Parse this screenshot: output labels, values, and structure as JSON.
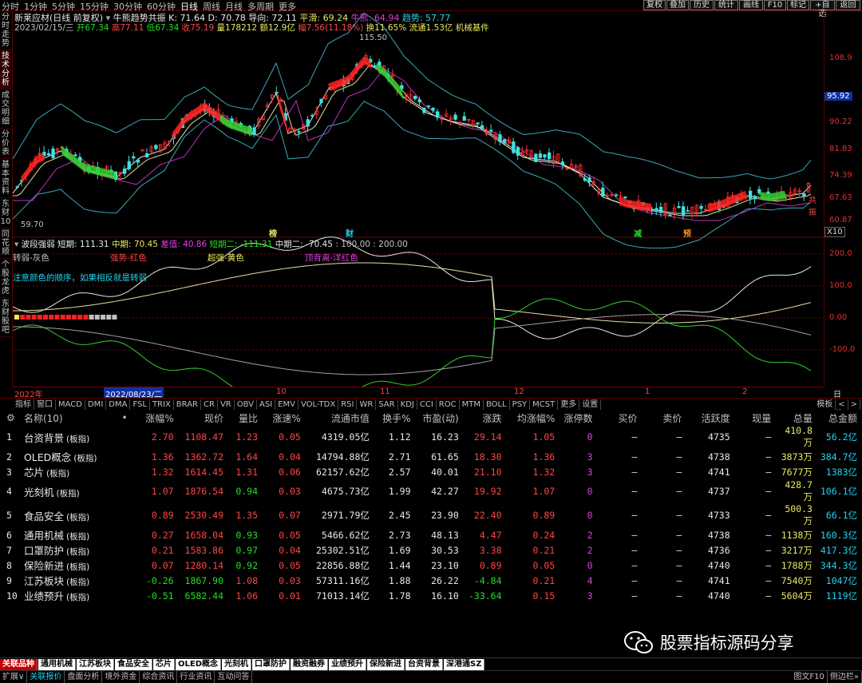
{
  "topbar": {
    "periods": [
      "分时",
      "1分钟",
      "5分钟",
      "15分钟",
      "30分钟",
      "60分钟",
      "日线",
      "周线",
      "月线",
      "多周期",
      "更多"
    ],
    "selected": "日线",
    "buttons": [
      "复权",
      "叠加",
      "历史",
      "统计",
      "画线",
      "F10",
      "标记",
      "+自选",
      "返回"
    ]
  },
  "lefttabs": [
    "分时走势",
    "技术分析",
    "成交明细",
    "分价表",
    "基本资料",
    "东财10",
    "同花顺",
    "个股龙虎",
    "东财股吧"
  ],
  "header": {
    "title": "新莱应材(日线 前复权)",
    "indicator_name": "牛熊趋势共振",
    "k": "K: 71.64",
    "d": "D: 70.78",
    "daoxiang": "导向: 72.11",
    "pinghua": "平滑: 69.24",
    "niuxiong": "牛熊: 64.94",
    "qushi": "趋势: 57.77",
    "date": "2023/02/15/三",
    "open": "开67.34",
    "high": "高77.11",
    "low": "低67.34",
    "close": "收75.19",
    "vol": "量178212",
    "amount": "额12.9亿",
    "amp": "幅7.56(11.18%)",
    "turnover": "换11.65%",
    "float": "流通1.53亿",
    "sector": "机械基件"
  },
  "price_scale": [
    "108.9",
    "95.92",
    "90.22",
    "81.83",
    "74.39",
    "67.63",
    "60.87"
  ],
  "price_current": "95.92",
  "chart_annotations": {
    "high": "115.50",
    "low": "59.70",
    "right_tag": "共振",
    "markers": [
      "榜",
      "财",
      "减",
      "预"
    ],
    "x10": "X10"
  },
  "sub": {
    "title": "波段强弱",
    "dq": "短期: 111.31",
    "zq": "中期: 70.45",
    "cz": "差值: 40.86",
    "dq2": "短期二: -111.31",
    "zq2": "中期二: -70.45",
    "range": ": 100.00 : 200.00",
    "legend1": "转弱-灰色",
    "legend2": "强势-红色",
    "legend3": "超强-黄色",
    "legend4": "顶背离-洋红色",
    "note": "注意颜色的顺序，如果相反就是转弱",
    "scale": [
      "200.0",
      "100.0",
      "0.00",
      "-100.0"
    ]
  },
  "xaxis": {
    "labels": [
      "2022年",
      "2022/08/23/二",
      "10",
      "11",
      "12",
      "1",
      "2"
    ],
    "right": "日线"
  },
  "ctoolbar": [
    "指标",
    "窗口",
    "MACD",
    "DMI",
    "DMA",
    "FSL",
    "TRIX",
    "BRAR",
    "CR",
    "VR",
    "OBV",
    "ASI",
    "EMV",
    "VOL-TDX",
    "RSI",
    "WR",
    "SAR",
    "KDJ",
    "CCI",
    "ROC",
    "MTM",
    "BOLL",
    "PSY",
    "MCST",
    "更多",
    "设置"
  ],
  "ctoolbar_right": [
    "模板",
    "<",
    ">"
  ],
  "table": {
    "headers": [
      "名称(10)",
      "•",
      "涨幅%",
      "现价",
      "量比",
      "涨速%",
      "流通市值",
      "换手%",
      "市盈(动)",
      "涨跌",
      "均涨幅%",
      "涨停数",
      "买价",
      "卖价",
      "活跃度",
      "现量",
      "总量",
      "总金额"
    ],
    "rows": [
      [
        "1",
        "台资背景",
        "(板指)",
        "2.70",
        "1108.47",
        "1.23",
        "0.05",
        "4319.05亿",
        "1.12",
        "16.23",
        "29.14",
        "1.05",
        "0",
        "—",
        "—",
        "4735",
        "—",
        "410.8万",
        "56.2亿"
      ],
      [
        "2",
        "OLED概念",
        "(板指)",
        "1.36",
        "1362.72",
        "1.64",
        "0.04",
        "14794.88亿",
        "2.71",
        "61.65",
        "18.30",
        "1.36",
        "3",
        "—",
        "—",
        "4738",
        "—",
        "3873万",
        "384.7亿"
      ],
      [
        "3",
        "芯片",
        "(板指)",
        "1.32",
        "1614.45",
        "1.31",
        "0.06",
        "62157.62亿",
        "2.57",
        "40.01",
        "21.10",
        "1.32",
        "3",
        "—",
        "—",
        "4741",
        "—",
        "7677万",
        "1383亿"
      ],
      [
        "4",
        "光刻机",
        "(板指)",
        "1.07",
        "1876.54",
        "0.94",
        "0.03",
        "4675.73亿",
        "1.99",
        "42.27",
        "19.92",
        "1.07",
        "0",
        "—",
        "—",
        "4737",
        "—",
        "428.7万",
        "106.1亿"
      ],
      [
        "5",
        "食品安全",
        "(板指)",
        "0.89",
        "2530.49",
        "1.35",
        "0.07",
        "2971.79亿",
        "2.45",
        "23.90",
        "22.40",
        "0.89",
        "0",
        "—",
        "—",
        "4733",
        "—",
        "500.3万",
        "66.1亿"
      ],
      [
        "6",
        "通用机械",
        "(板指)",
        "0.27",
        "1658.04",
        "0.93",
        "0.05",
        "5466.62亿",
        "2.73",
        "48.13",
        "4.47",
        "0.24",
        "2",
        "—",
        "—",
        "4738",
        "—",
        "1138万",
        "160.3亿"
      ],
      [
        "7",
        "口罩防护",
        "(板指)",
        "0.21",
        "1583.86",
        "0.97",
        "0.04",
        "25302.51亿",
        "1.69",
        "30.53",
        "3.38",
        "0.21",
        "2",
        "—",
        "—",
        "4736",
        "—",
        "3217万",
        "417.3亿"
      ],
      [
        "8",
        "保险新进",
        "(板指)",
        "0.07",
        "1280.14",
        "0.92",
        "0.05",
        "22856.88亿",
        "1.44",
        "23.10",
        "0.89",
        "0.05",
        "0",
        "—",
        "—",
        "4740",
        "—",
        "1788万",
        "344.3亿"
      ],
      [
        "9",
        "江苏板块",
        "(板指)",
        "-0.26",
        "1867.90",
        "1.08",
        "0.03",
        "57311.16亿",
        "1.88",
        "26.22",
        "-4.84",
        "0.21",
        "4",
        "—",
        "—",
        "4741",
        "—",
        "7540万",
        "1047亿"
      ],
      [
        "10",
        "业绩预升",
        "(板指)",
        "-0.51",
        "6582.44",
        "1.06",
        "0.01",
        "71013.14亿",
        "1.78",
        "16.10",
        "-33.64",
        "0.15",
        "3",
        "—",
        "—",
        "4740",
        "—",
        "5604万",
        "1119亿"
      ]
    ]
  },
  "btabs": [
    "关联品种",
    "通用机械",
    "江苏板块",
    "食品安全",
    "芯片",
    "OLED概念",
    "光刻机",
    "口罩防护",
    "融资融券",
    "业绩预升",
    "保险新进",
    "台资背景",
    "深港通SZ"
  ],
  "status": [
    "扩展∨",
    "关联报价",
    "盘面分析",
    "境外资金",
    "综合资讯",
    "行业资讯",
    "互动问答"
  ],
  "status_right": [
    "图文F10",
    "侧边栏»"
  ],
  "watermark": "股票指标源码分享",
  "colors": {
    "up": "#ff4545",
    "down": "#20e020",
    "accent": "#c00000"
  }
}
